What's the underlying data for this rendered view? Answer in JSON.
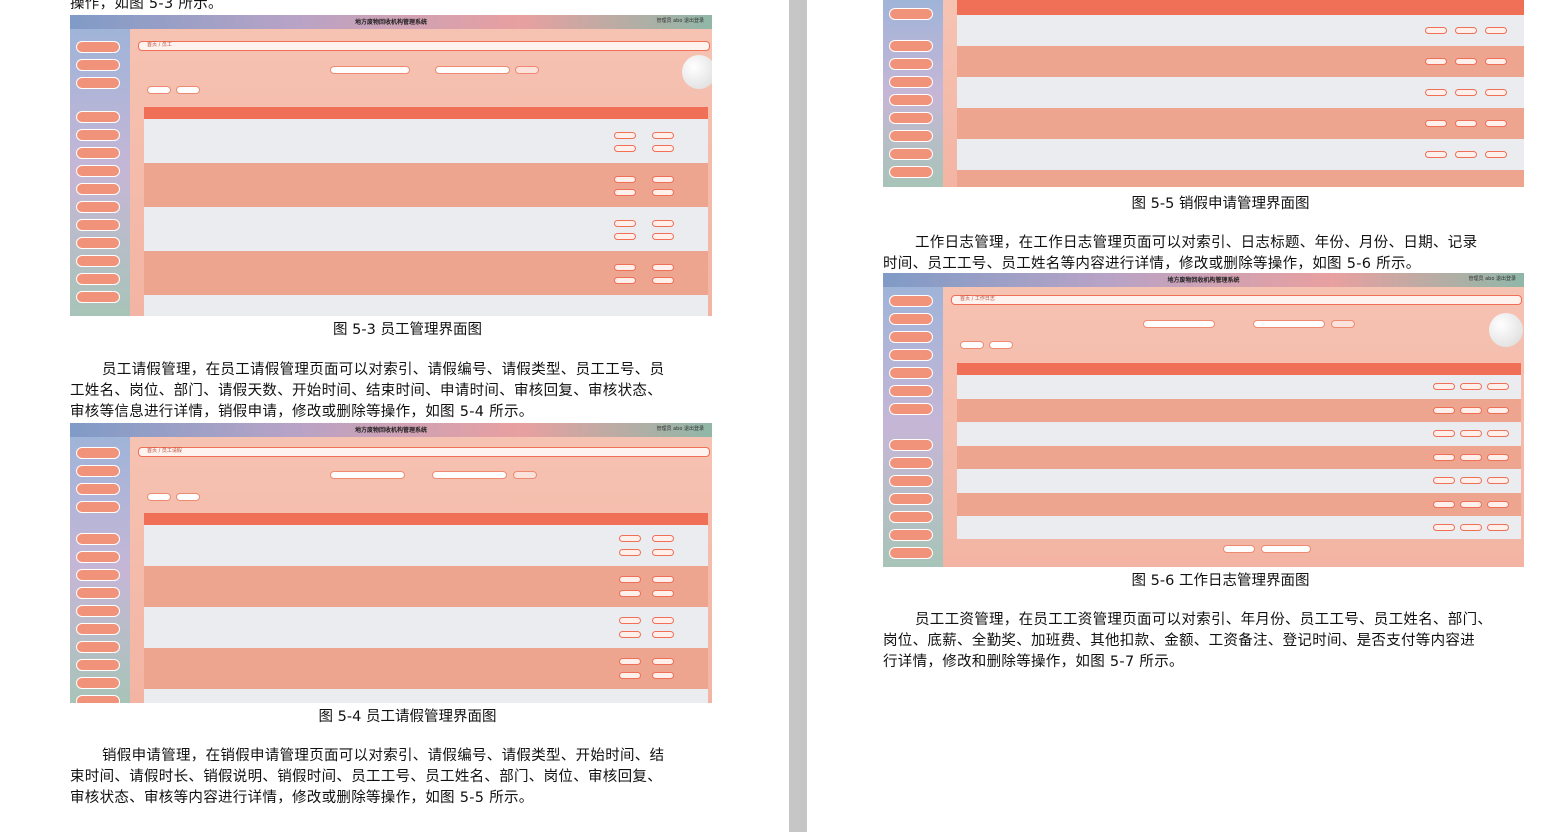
{
  "left_page": {
    "top_line": "操作，如图 5-3 所示。",
    "caption_fig3": "图 5-3 员工管理界面图",
    "para_leave": "员工请假管理，在员工请假管理页面可以对索引、请假编号、请假类型、员工工号、员工姓名、岗位、部门、请假天数、开始时间、结束时间、申请时间、审核回复、审核状态、审核等信息进行详情，销假申请，修改或删除等操作，如图 5-4 所示。",
    "para_leave_lines": [
      "员工请假管理，在员工请假管理页面可以对索引、请假编号、请假类型、员工工号、员",
      "工姓名、岗位、部门、请假天数、开始时间、结束时间、申请时间、审核回复、审核状态、",
      "审核等信息进行详情，销假申请，修改或删除等操作，如图 5-4 所示。"
    ],
    "caption_fig4": "图 5-4 员工请假管理界面图",
    "para_cancel_lines": [
      "销假申请管理，在销假申请管理页面可以对索引、请假编号、请假类型、开始时间、结",
      "束时间、请假时长、销假说明、销假时间、员工工号、员工姓名、部门、岗位、审核回复、",
      "审核状态、审核等内容进行详情，修改或删除等操作，如图 5-5 所示。"
    ]
  },
  "right_page": {
    "caption_fig5": "图 5-5 销假申请管理界面图",
    "para_log_lines": [
      "工作日志管理，在工作日志管理页面可以对索引、日志标题、年份、月份、日期、记录",
      "时间、员工工号、员工姓名等内容进行详情，修改或删除等操作，如图 5-6 所示。"
    ],
    "caption_fig6": "图 5-6 工作日志管理界面图",
    "para_salary_lines": [
      "员工工资管理，在员工工资管理页面可以对索引、年月份、员工工号、员工姓名、部门、",
      "岗位、底薪、全勤奖、加班费、其他扣款、金额、工资备注、登记时间、是否支付等内容进",
      "行详情，修改和删除等操作，如图 5-7 所示。"
    ]
  },
  "screens": {
    "system_title": "地方废物回收机构管理系统",
    "fig3": {
      "breadcrumb": "首页 / 员工",
      "user": "管理员 abo  退出登录"
    },
    "fig4": {
      "breadcrumb": "首页 / 员工请假",
      "user": "管理员 abo  退出登录"
    },
    "fig6": {
      "breadcrumb": "首页 / 工作日志",
      "user": "管理员 abo  退出登录"
    }
  }
}
